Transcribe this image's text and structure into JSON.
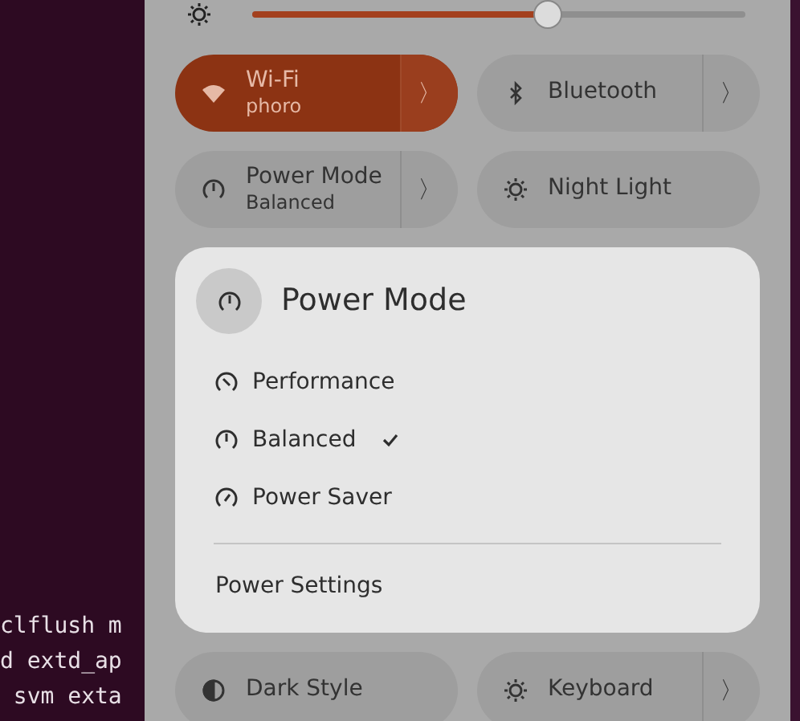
{
  "terminal_lines": [
    "clflush m",
    "d extd_ap",
    " svm exta"
  ],
  "brightness": {
    "level": 0.6
  },
  "tiles": [
    {
      "kind": "split",
      "label": "Wi-Fi",
      "subtitle": "phoro",
      "on": true,
      "arrow": "〉"
    },
    {
      "kind": "split",
      "label": "Bluetooth",
      "on": false,
      "arrow": "〉"
    },
    {
      "kind": "split",
      "label": "Power Mode",
      "subtitle": "Balanced",
      "on": false,
      "arrow": "〉"
    },
    {
      "kind": "toggle",
      "label": "Night Light",
      "on": false
    }
  ],
  "popup": {
    "title": "Power Mode",
    "options": [
      {
        "label": "Performance",
        "selected": false
      },
      {
        "label": "Balanced",
        "selected": true
      },
      {
        "label": "Power Saver",
        "selected": false
      }
    ],
    "settings_link": "Power Settings"
  },
  "bottom_tiles": [
    {
      "kind": "toggle",
      "label": "Dark Style",
      "on": false
    },
    {
      "kind": "split",
      "label": "Keyboard",
      "on": false,
      "arrow": "〉"
    }
  ]
}
